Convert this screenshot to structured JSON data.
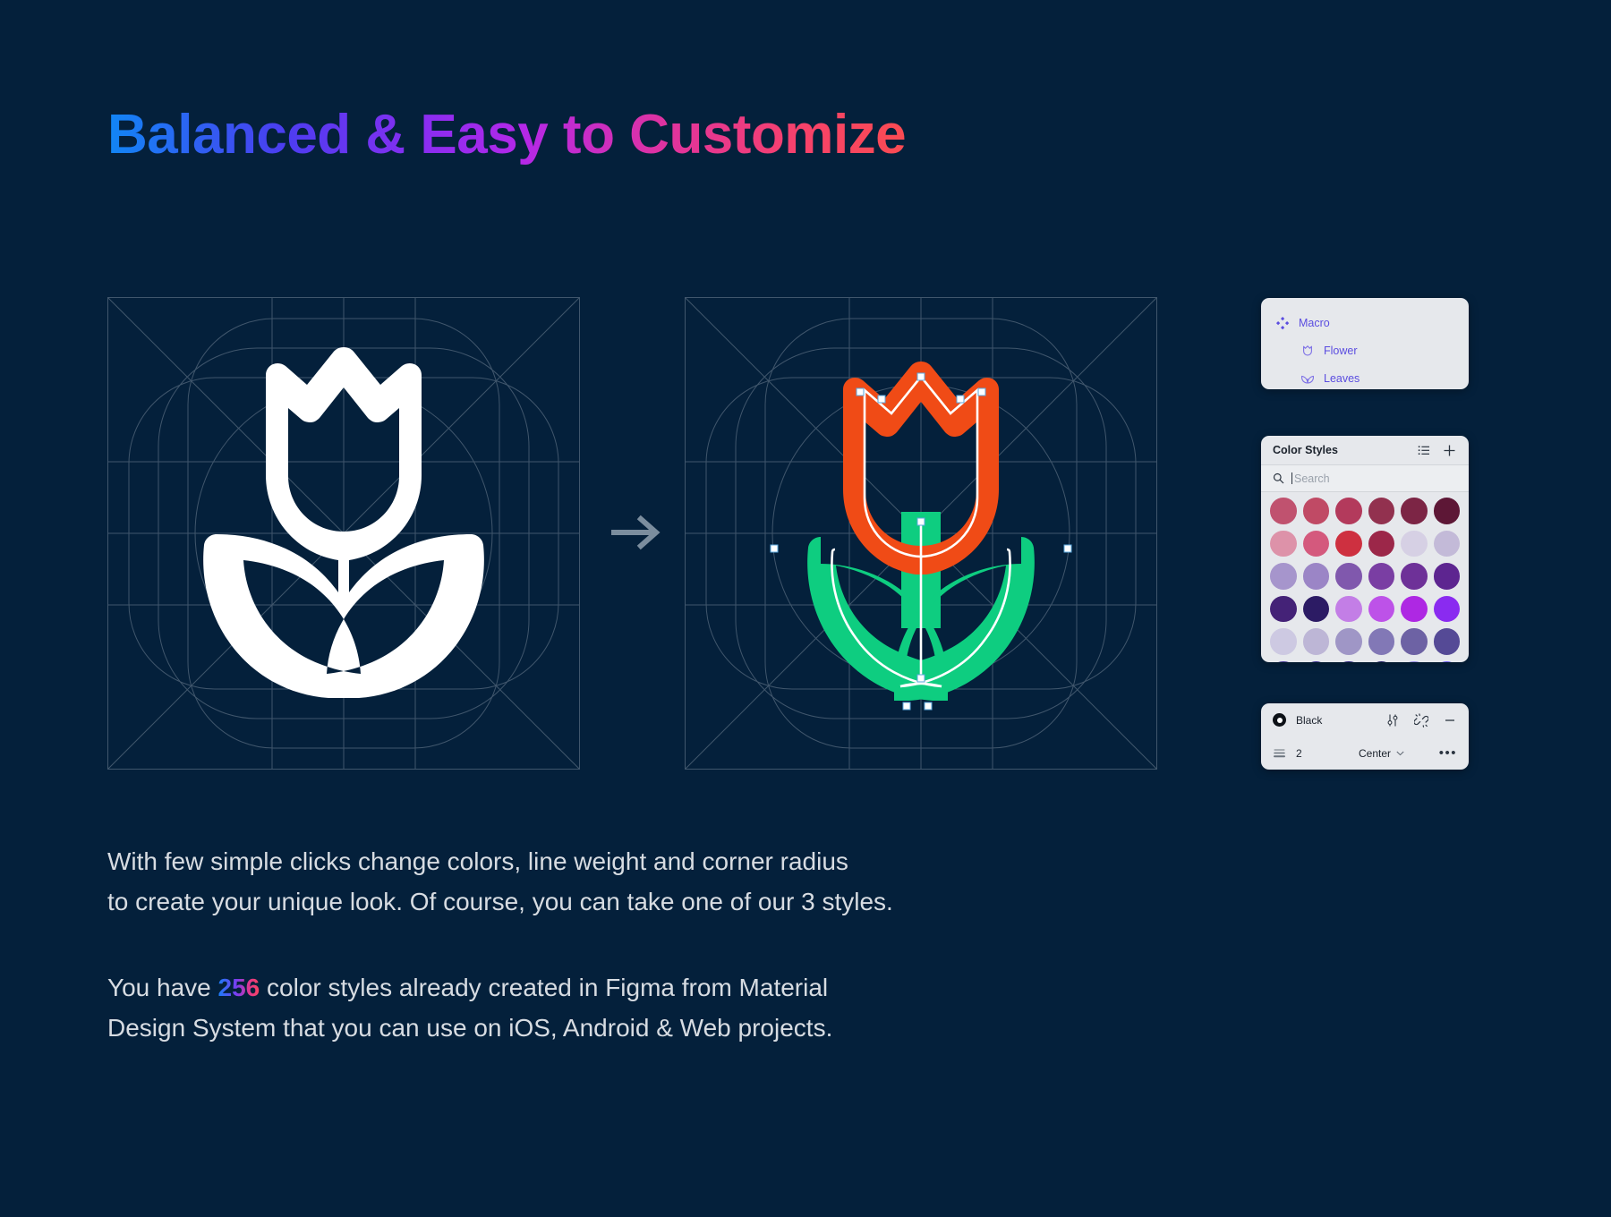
{
  "page": {
    "title": "Balanced & Easy to Customize",
    "background_color": "#04203b"
  },
  "artboards": {
    "left": {
      "name": "icon-grid-outline-white",
      "icon_color": "#ffffff"
    },
    "right": {
      "name": "icon-grid-colored-vector",
      "flower_color": "#f04b16",
      "leaf_color": "#0ecd80",
      "path_color": "#ffffff"
    },
    "arrow": {
      "name": "transform-arrow",
      "color": "#7b8d9e"
    }
  },
  "layers_panel": {
    "items": [
      {
        "label": "Macro",
        "icon": "component-icon",
        "depth": 0
      },
      {
        "label": "Flower",
        "icon": "flower-outline-icon",
        "depth": 1
      },
      {
        "label": "Leaves",
        "icon": "leaves-outline-icon",
        "depth": 1
      }
    ],
    "text_color": "#5b4de0"
  },
  "styles_panel": {
    "title": "Color Styles",
    "list_icon": "list-view-icon",
    "add_icon": "plus-icon",
    "search": {
      "icon": "search-icon",
      "placeholder": "Search",
      "value": ""
    },
    "swatches": [
      "#c0526f",
      "#c04a65",
      "#b33a5c",
      "#92314f",
      "#7c2545",
      "#5d1736",
      "#dd92a9",
      "#d4597d",
      "#ce3040",
      "#9c2749",
      "#d6d0e4",
      "#c3bad8",
      "#a695cc",
      "#9b85c6",
      "#8058ad",
      "#7a3ea3",
      "#6e3198",
      "#5d2590",
      "#442277",
      "#2c1b64",
      "#c37ee6",
      "#bd52e8",
      "#ae28e3",
      "#8a2bf0",
      "#cdc9e2",
      "#bdb6d6",
      "#9f96c6",
      "#8278b6",
      "#6d62a4",
      "#554a96",
      "#4a3d97",
      "#3c3190",
      "#332a80",
      "#211c63",
      "#9287e0",
      "#6a5bf0"
    ]
  },
  "stroke_panel": {
    "color_name": "Black",
    "color_hex": "#0d1117",
    "adjust_icon": "sliders-icon",
    "detach_icon": "detach-style-icon",
    "remove_icon": "minus-icon",
    "weight_icon": "stroke-weight-icon",
    "weight": "2",
    "alignment": "Center",
    "alignment_chevron": "chevron-down-icon",
    "more_icon": "more-options-icon"
  },
  "body": {
    "paragraph_1_a": "With few simple clicks change colors, line weight and corner radius",
    "paragraph_1_b": "to create your unique look. Of course, you can take one of our 3 styles.",
    "paragraph_2_pre": "You have ",
    "paragraph_2_highlight": "256",
    "paragraph_2_post": " color styles already created in Figma from Material",
    "paragraph_2_line2": "Design System that you can use on iOS, Android & Web projects."
  }
}
